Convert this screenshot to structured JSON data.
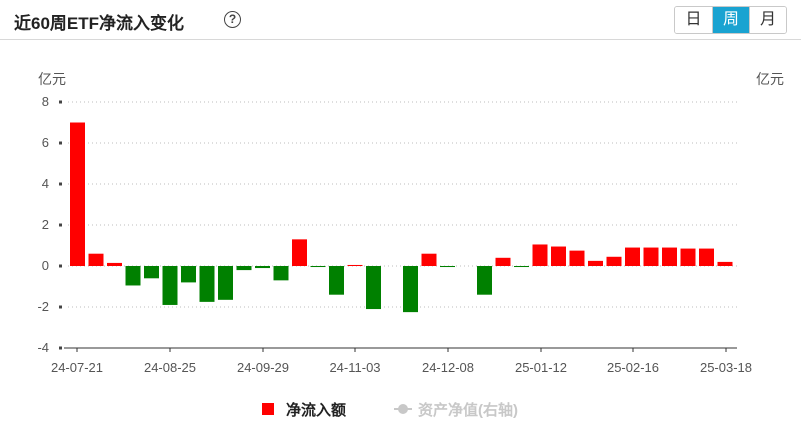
{
  "header": {
    "title": "近60周ETF净流入变化",
    "help_icon": "question-circle-icon",
    "tabs": [
      {
        "label": "日",
        "active": false
      },
      {
        "label": "周",
        "active": true
      },
      {
        "label": "月",
        "active": false
      }
    ]
  },
  "colors": {
    "positive": "#ff0000",
    "negative": "#008000",
    "tab_active": "#1aa3d1",
    "legend_disabled": "#c8c8c8"
  },
  "chart_data": {
    "type": "bar",
    "left_unit": "亿元",
    "right_unit": "亿元",
    "ylim": [
      -4,
      8
    ],
    "yticks": [
      -4,
      -2,
      0,
      2,
      4,
      6,
      8
    ],
    "grid": "dotted horizontal",
    "x_labels": [
      "24-07-21",
      "24-08-25",
      "24-09-29",
      "24-11-03",
      "24-12-08",
      "25-01-12",
      "25-02-16",
      "25-03-18"
    ],
    "series": [
      {
        "name": "净流入额",
        "values": [
          7.0,
          0.6,
          0.15,
          -0.95,
          -0.6,
          -1.9,
          -0.8,
          -1.75,
          -1.65,
          -0.2,
          -0.1,
          -0.7,
          1.3,
          -0.05,
          -1.4,
          0.05,
          -2.1,
          0.0,
          -2.25,
          0.6,
          -0.05,
          0.0,
          -1.4,
          0.4,
          -0.05,
          1.05,
          0.95,
          0.75,
          0.25,
          0.45,
          0.9,
          0.9,
          0.9,
          0.85,
          0.85,
          0.2
        ]
      }
    ],
    "legend": [
      {
        "label": "净流入额",
        "enabled": true
      },
      {
        "label": "资产净值(右轴)",
        "enabled": false
      }
    ]
  }
}
